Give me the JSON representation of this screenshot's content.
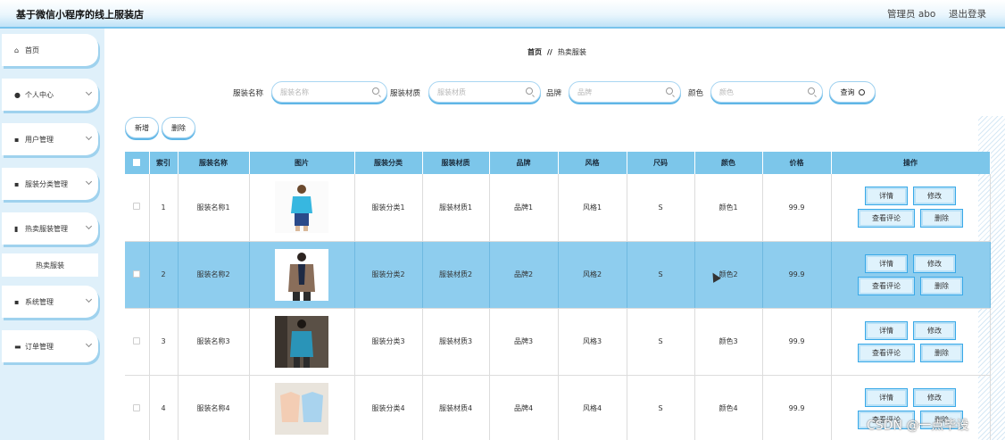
{
  "header": {
    "title": "基于微信小程序的线上服装店",
    "admin_label": "管理员 abo",
    "logout_label": "退出登录"
  },
  "sidebar": {
    "items": [
      {
        "label": "首页",
        "icon": "home-icon",
        "glyph": "⌂"
      },
      {
        "label": "个人中心",
        "icon": "user-icon",
        "glyph": "●"
      },
      {
        "label": "用户管理",
        "icon": "grid-icon",
        "glyph": "▪"
      },
      {
        "label": "服装分类管理",
        "icon": "grid-icon",
        "glyph": "▪"
      },
      {
        "label": "热卖服装管理",
        "icon": "chart-icon",
        "glyph": "▮"
      },
      {
        "label": "热卖服装",
        "icon": "",
        "glyph": ""
      },
      {
        "label": "系统管理",
        "icon": "grid-icon",
        "glyph": "▪"
      },
      {
        "label": "订单管理",
        "icon": "order-icon",
        "glyph": "▬"
      }
    ]
  },
  "breadcrumb": {
    "home": "首页",
    "sep": "//",
    "current": "热卖服装"
  },
  "search": {
    "name_label": "服装名称",
    "name_placeholder": "服装名称",
    "material_label": "服装材质",
    "material_placeholder": "服装材质",
    "brand_label": "品牌",
    "brand_placeholder": "品牌",
    "color_label": "颜色",
    "color_placeholder": "颜色",
    "query_label": "查询"
  },
  "toolbar": {
    "add_label": "新增",
    "delete_label": "删除"
  },
  "table": {
    "headers": [
      "",
      "索引",
      "服装名称",
      "图片",
      "服装分类",
      "服装材质",
      "品牌",
      "风格",
      "尺码",
      "颜色",
      "价格",
      "操作"
    ],
    "rows": [
      {
        "index": "1",
        "name": "服装名称1",
        "category": "服装分类1",
        "material": "服装材质1",
        "brand": "品牌1",
        "style": "风格1",
        "size": "S",
        "color": "颜色1",
        "price": "99.9"
      },
      {
        "index": "2",
        "name": "服装名称2",
        "category": "服装分类2",
        "material": "服装材质2",
        "brand": "品牌2",
        "style": "风格2",
        "size": "S",
        "color": "颜色2",
        "price": "99.9"
      },
      {
        "index": "3",
        "name": "服装名称3",
        "category": "服装分类3",
        "material": "服装材质3",
        "brand": "品牌3",
        "style": "风格3",
        "size": "S",
        "color": "颜色3",
        "price": "99.9"
      },
      {
        "index": "4",
        "name": "服装名称4",
        "category": "服装分类4",
        "material": "服装材质4",
        "brand": "品牌4",
        "style": "风格4",
        "size": "S",
        "color": "颜色4",
        "price": "99.9"
      }
    ],
    "actions": {
      "detail": "详情",
      "edit": "修改",
      "review": "查看评论",
      "delete": "删除"
    }
  },
  "watermark": "CSDN @一点毕设",
  "colors": {
    "accent": "#39a9e8",
    "header_row": "#7cc6ea",
    "highlight_row": "#8ecdee",
    "sidebar_bg": "#dff0fa"
  }
}
